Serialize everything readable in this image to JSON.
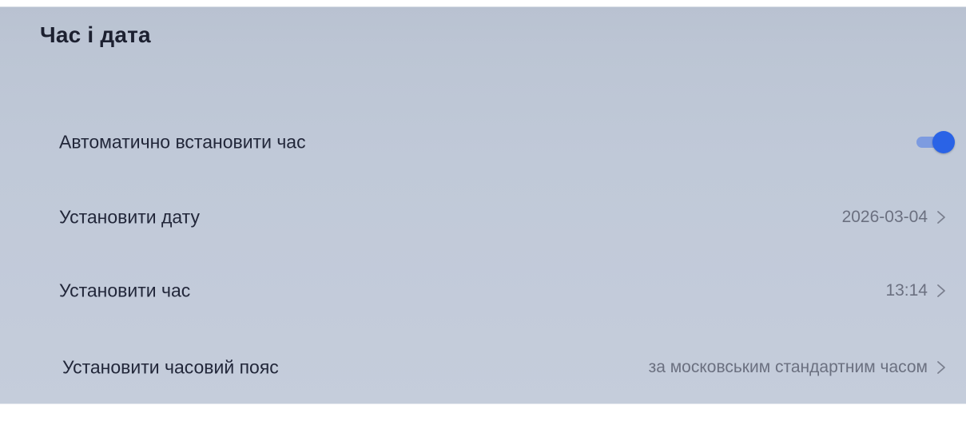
{
  "header": {
    "title": "Час і дата"
  },
  "settings": {
    "auto_time": {
      "label": "Автоматично встановити час",
      "enabled": true
    },
    "set_date": {
      "label": "Установити дату",
      "value": "2026-03-04"
    },
    "set_time": {
      "label": "Установити час",
      "value": "13:14"
    },
    "set_timezone": {
      "label": "Установити часовий пояс",
      "value": "за московським стандартним часом"
    }
  },
  "icons": {
    "row_arrow": "chevron-right-icon"
  },
  "colors": {
    "toggle_on": "#2a63e6",
    "toggle_track": "#7d9be0",
    "background": "#bfc8d7",
    "text_primary": "#22273a",
    "text_secondary": "#6b7080"
  }
}
